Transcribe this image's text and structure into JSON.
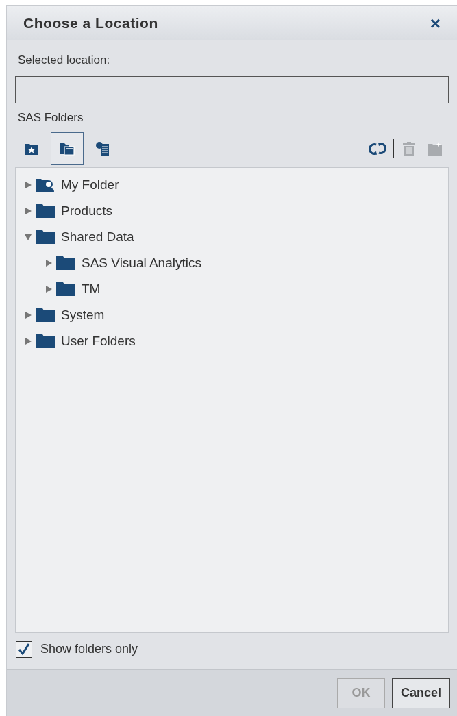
{
  "dialog": {
    "title": "Choose a Location",
    "close_label": "×"
  },
  "selected_location": {
    "label": "Selected location:"
  },
  "folders_label": "SAS Folders",
  "view_buttons": [
    {
      "kind": "favorites",
      "selected": false
    },
    {
      "kind": "folders",
      "selected": true
    },
    {
      "kind": "servers",
      "selected": false
    }
  ],
  "action_buttons": [
    {
      "kind": "refresh",
      "disabled": false
    },
    {
      "kind": "delete",
      "disabled": true
    },
    {
      "kind": "new-folder",
      "disabled": true
    }
  ],
  "tree": [
    {
      "label": "My Folder",
      "kind": "personal",
      "expanded": false
    },
    {
      "label": "Products",
      "kind": "folder",
      "expanded": false
    },
    {
      "label": "Shared Data",
      "kind": "folder",
      "expanded": true,
      "children": [
        {
          "label": "SAS Visual Analytics",
          "kind": "folder",
          "expanded": false
        },
        {
          "label": "TM",
          "kind": "folder",
          "expanded": false
        }
      ]
    },
    {
      "label": "System",
      "kind": "folder",
      "expanded": false
    },
    {
      "label": "User Folders",
      "kind": "folder",
      "expanded": false
    }
  ],
  "show_folders_only": {
    "label": "Show folders only",
    "checked": true
  },
  "buttons": [
    {
      "label": "OK",
      "disabled": true
    },
    {
      "label": "Cancel",
      "disabled": false
    }
  ]
}
